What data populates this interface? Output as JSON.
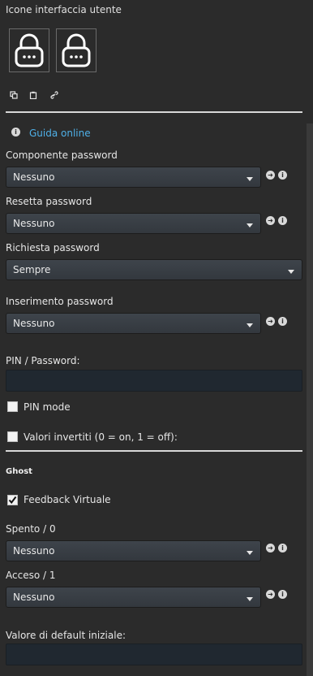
{
  "panel": {
    "title": "Icone interfaccia utente",
    "help_link": "Guida online"
  },
  "fields": [
    {
      "label": "Componente password",
      "value": "Nessuno"
    },
    {
      "label": "Resetta password",
      "value": "Nessuno"
    },
    {
      "label": "Richiesta password",
      "value": "Sempre"
    },
    {
      "label": "Inserimento password",
      "value": "Nessuno"
    }
  ],
  "pin": {
    "label": "PIN / Password:",
    "value": ""
  },
  "checkboxes": [
    {
      "label": "PIN mode",
      "checked": false
    },
    {
      "label": "Valori invertiti (0 = on, 1 = off):",
      "checked": false
    }
  ],
  "ghost": {
    "title": "Ghost",
    "feedback_label": "Feedback Virtuale",
    "feedback_checked": true,
    "off_label": "Spento / 0",
    "off_value": "Nessuno",
    "on_label": "Acceso / 1",
    "on_value": "Nessuno",
    "default_label": "Valore di default iniziale:",
    "default_value": ""
  },
  "icons": {
    "lock": "lock-icon",
    "copy": "copy-icon",
    "paste": "clipboard-icon",
    "link": "link-icon",
    "info": "info-icon",
    "go": "arrow-right-circle-icon"
  }
}
